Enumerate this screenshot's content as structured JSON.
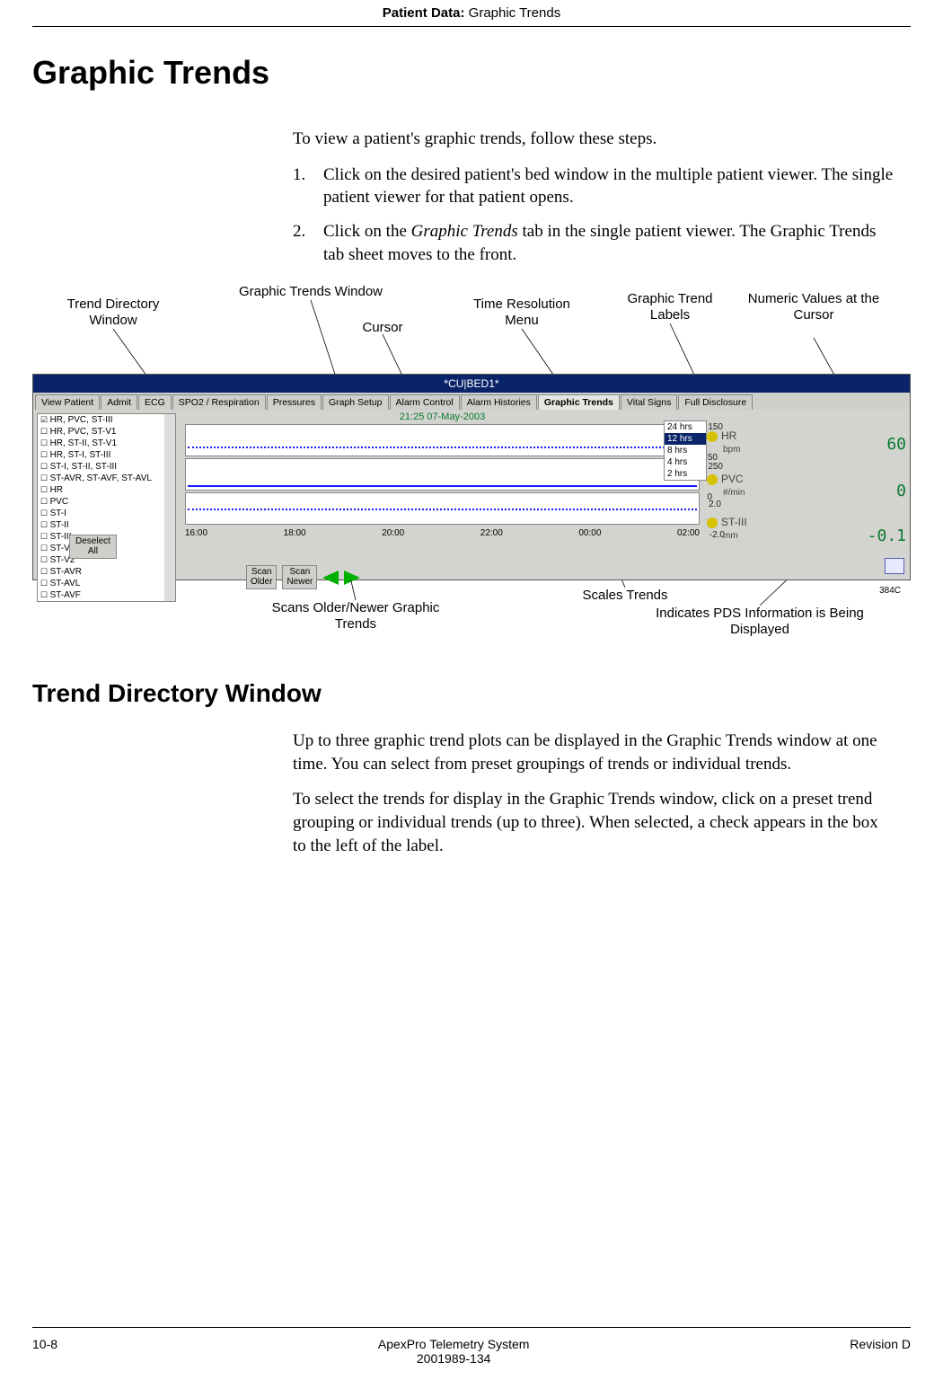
{
  "header": {
    "section": "Patient Data:",
    "subsection": " Graphic Trends"
  },
  "title": "Graphic Trends",
  "intro": "To view a patient's graphic trends, follow these steps.",
  "steps": [
    {
      "num": "1.",
      "text_a": "Click on the desired patient's bed window in the multiple patient viewer. The single patient viewer for that patient opens."
    },
    {
      "num": "2.",
      "text_a": "Click on the ",
      "italic": "Graphic Trends",
      "text_b": " tab in the single patient viewer. The Graphic Trends tab sheet moves to the front."
    }
  ],
  "callouts_top": {
    "trenddir": "Trend Directory Window",
    "gtw": "Graphic Trends Window",
    "cursor": "Cursor",
    "tres": "Time Resolution Menu",
    "labels": "Graphic Trend Labels",
    "numeric": "Numeric Values at the Cursor"
  },
  "screenshot": {
    "title": "*CU|BED1*",
    "tabs": [
      "View Patient",
      "Admit",
      "ECG",
      "SPO2 / Respiration",
      "Pressures",
      "Graph Setup",
      "Alarm Control",
      "Alarm Histories",
      "Graphic Trends",
      "Vital Signs",
      "Full Disclosure"
    ],
    "active_tab": "Graphic Trends",
    "timestamp": "21:25 07-May-2003",
    "dir_items": [
      {
        "label": "HR, PVC, ST-III",
        "checked": true
      },
      {
        "label": "HR, PVC, ST-V1",
        "checked": false
      },
      {
        "label": "HR, ST-II, ST-V1",
        "checked": false
      },
      {
        "label": "HR, ST-I, ST-III",
        "checked": false
      },
      {
        "label": "ST-I, ST-II, ST-III",
        "checked": false
      },
      {
        "label": "ST-AVR, ST-AVF, ST-AVL",
        "checked": false
      },
      {
        "label": "HR",
        "checked": false
      },
      {
        "label": "PVC",
        "checked": false
      },
      {
        "label": "ST-I",
        "checked": false
      },
      {
        "label": "ST-II",
        "checked": false
      },
      {
        "label": "ST-III",
        "checked": false
      },
      {
        "label": "ST-V1",
        "checked": false
      },
      {
        "label": "ST-V2",
        "checked": false
      },
      {
        "label": "ST-AVR",
        "checked": false
      },
      {
        "label": "ST-AVL",
        "checked": false
      },
      {
        "label": "ST-AVF",
        "checked": false
      }
    ],
    "deselect": "Deselect\nAll",
    "tres_options": [
      "24 hrs",
      "12 hrs",
      "8 hrs",
      "4 hrs",
      "2 hrs"
    ],
    "tres_selected": "12 hrs",
    "xaxis": [
      "16:00",
      "18:00",
      "20:00",
      "22:00",
      "00:00",
      "02:00"
    ],
    "scan_older": "Scan\nOlder",
    "scan_newer": "Scan\nNewer",
    "scales": {
      "p1_top": "150",
      "p1_bot": "50",
      "p2_top": "250",
      "p2_bot": "0",
      "p3_top": "2.0",
      "p3_bot": "-2.0"
    },
    "side_labels": [
      {
        "name": "HR",
        "unit": "bpm"
      },
      {
        "name": "PVC",
        "unit": "#/min"
      },
      {
        "name": "ST-III",
        "unit": "mm"
      }
    ],
    "cursor_values": {
      "v1": "60",
      "v2": "0",
      "v3": "-0.1"
    },
    "pds_id": "384C"
  },
  "callouts_bottom": {
    "scans": "Scans Older/Newer Graphic Trends",
    "scales": "Scales Trends",
    "pds": "Indicates PDS Information is Being Displayed"
  },
  "subhead": "Trend Directory Window",
  "para2": "Up to three graphic trend plots can be displayed in the Graphic Trends window at one time. You can select from preset groupings of trends or individual trends.",
  "para3": "To select the trends for display in the Graphic Trends window, click on a preset trend grouping or individual trends (up to three). When selected, a check appears in the box to the left of the label.",
  "footer": {
    "page": "10-8",
    "center1": "ApexPro Telemetry System",
    "center2": "2001989-134",
    "right": "Revision D"
  }
}
